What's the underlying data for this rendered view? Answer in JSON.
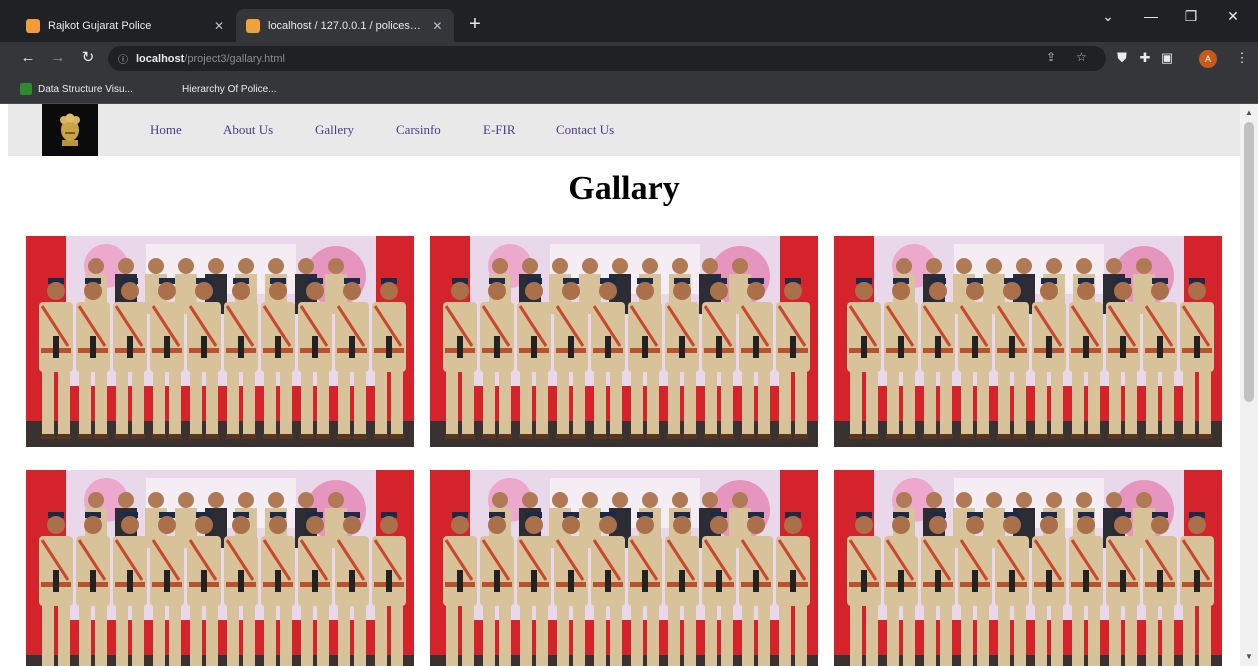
{
  "browser": {
    "tabs": [
      {
        "title": "Rajkot Gujarat Police",
        "favicon_color": "#f29c37",
        "active": false
      },
      {
        "title": "localhost / 127.0.0.1 / policestati...",
        "favicon_color": "#f0a23c",
        "active": true
      }
    ],
    "new_tab_label": "+",
    "close_glyph": "✕",
    "url_host": "localhost",
    "url_path": "/project3/gallary.html",
    "bookmarks": [
      {
        "label": "Data Structure Visu...",
        "icon_color": "#2d8a2d"
      },
      {
        "label": "Hierarchy Of Police...",
        "icon_color": "#35363a"
      }
    ],
    "profile_initial": "A"
  },
  "site": {
    "nav": [
      {
        "label": "Home"
      },
      {
        "label": "About Us"
      },
      {
        "label": "Gallery"
      },
      {
        "label": "Carsinfo"
      },
      {
        "label": "E-FIR"
      },
      {
        "label": "Contact Us"
      }
    ],
    "page_title": "Gallary",
    "gallery_count": 6,
    "colors": {
      "nav_bg": "#e9e9e9",
      "nav_link": "#4b3b8c",
      "uniform": "#d8c29a",
      "backdrop": "#d4232a"
    }
  }
}
